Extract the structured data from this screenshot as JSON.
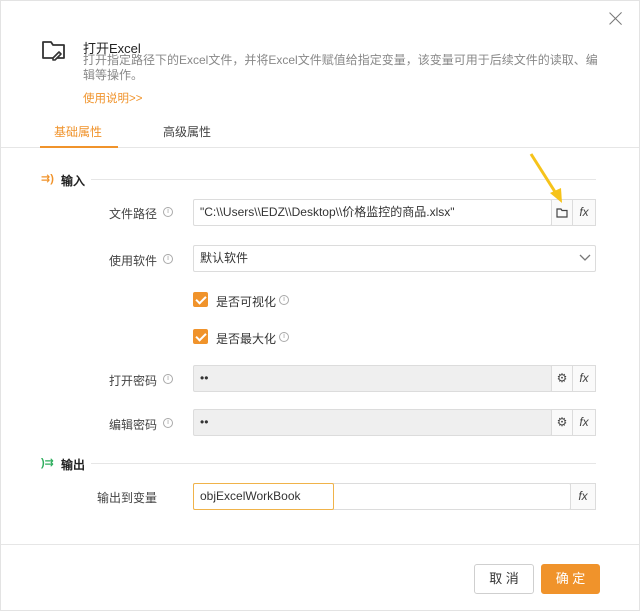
{
  "header": {
    "title": "打开Excel",
    "description": "打开指定路径下的Excel文件，并将Excel文件赋值给指定变量，该变量可用于后续文件的读取、编辑等操作。",
    "help_link": "使用说明>>"
  },
  "tabs": [
    {
      "label": "基础属性"
    },
    {
      "label": "高级属性"
    }
  ],
  "input_section": {
    "title": "输入",
    "icon": "⇉)",
    "file_path": {
      "label": "文件路径",
      "value": "\"C:\\\\Users\\\\EDZ\\\\Desktop\\\\价格监控的商品.xlsx\""
    },
    "software": {
      "label": "使用软件",
      "value": "默认软件"
    },
    "visible": {
      "label": "是否可视化",
      "checked": true
    },
    "maximize": {
      "label": "是否最大化",
      "checked": true
    },
    "open_password": {
      "label": "打开密码",
      "value": "••"
    },
    "edit_password": {
      "label": "编辑密码",
      "value": "••"
    }
  },
  "output_section": {
    "title": "输出",
    "icon": ")⇉",
    "output_var": {
      "label": "输出到变量",
      "value": "objExcelWorkBook"
    }
  },
  "buttons": {
    "fx": "fx",
    "cancel": "取 消",
    "ok": "确 定"
  },
  "accent_color": "#f0932b"
}
